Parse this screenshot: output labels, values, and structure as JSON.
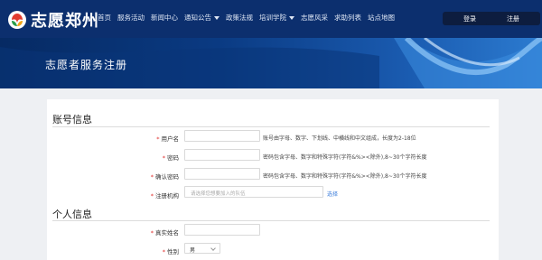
{
  "brand": {
    "name": "志愿郑州"
  },
  "nav": {
    "items": [
      {
        "label": "首页",
        "dropdown": false
      },
      {
        "label": "服务活动",
        "dropdown": false
      },
      {
        "label": "新闻中心",
        "dropdown": false
      },
      {
        "label": "通知公告",
        "dropdown": true
      },
      {
        "label": "政策法规",
        "dropdown": false
      },
      {
        "label": "培训学院",
        "dropdown": true
      },
      {
        "label": "志愿风采",
        "dropdown": false
      },
      {
        "label": "求助列表",
        "dropdown": false
      },
      {
        "label": "站点地图",
        "dropdown": false
      }
    ],
    "login_label": "登录",
    "register_label": "注册"
  },
  "page": {
    "title": "志愿者服务注册"
  },
  "account_section": {
    "title": "账号信息",
    "username": {
      "label": "用户名",
      "hint": "账号由字母、数字、下划线、中横线和中文组成，长度为2-18位",
      "value": ""
    },
    "password": {
      "label": "密码",
      "hint": "密码包含字母、数字和特殊字符(字符&%><除外),8~30个字符长度",
      "value": ""
    },
    "confirm_password": {
      "label": "确认密码",
      "hint": "密码包含字母、数字和特殊字符(字符&%><除外),8~30个字符长度",
      "value": ""
    },
    "org": {
      "label": "注册机构",
      "placeholder": "请选择您想要加入的队伍",
      "select_label": "选择"
    }
  },
  "personal_section": {
    "title": "个人信息",
    "real_name": {
      "label": "真实姓名",
      "value": ""
    },
    "gender": {
      "label": "性别",
      "value": "男"
    }
  },
  "colors": {
    "required": "#e0322f",
    "link": "#3b7ddb",
    "header": "#0c2f6e"
  }
}
